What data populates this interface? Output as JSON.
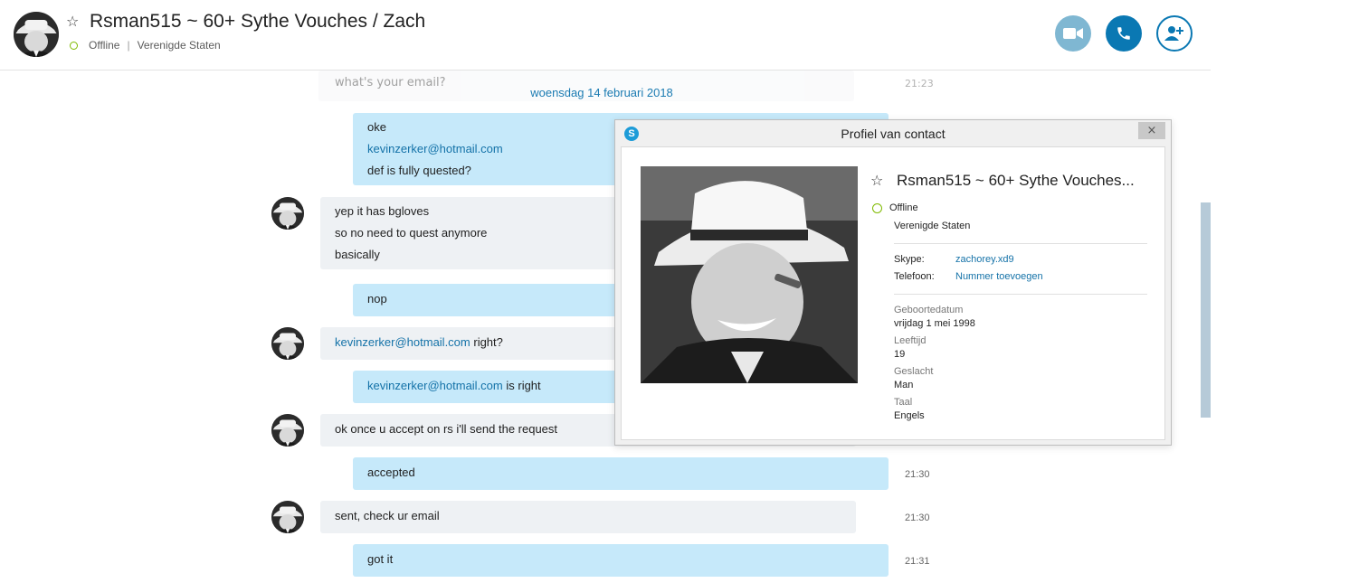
{
  "header": {
    "title": "Rsman515 ~ 60+ Sythe Vouches / Zach",
    "status": "Offline",
    "separator": "|",
    "location": "Verenigde Staten"
  },
  "chat": {
    "faded_message": "what's your email?",
    "faded_time": "21:23",
    "date_separator": "woensdag 14 februari 2018",
    "messages": [
      {
        "sender": "me",
        "lines": [
          "oke",
          "kevinzerker@hotmail.com",
          "def is fully quested?"
        ]
      },
      {
        "sender": "them",
        "lines": [
          "yep it has bgloves",
          "so no need to quest anymore",
          "basically"
        ]
      },
      {
        "sender": "me",
        "lines": [
          "nop"
        ]
      },
      {
        "sender": "them",
        "link": "kevinzerker@hotmail.com",
        "text": " right?"
      },
      {
        "sender": "me",
        "link": "kevinzerker@hotmail.com",
        "text": " is right"
      },
      {
        "sender": "them",
        "lines": [
          "ok once u accept on rs i'll send the request"
        ]
      },
      {
        "sender": "me",
        "lines": [
          "accepted"
        ],
        "time": "21:30"
      },
      {
        "sender": "them",
        "lines": [
          "sent, check ur email"
        ],
        "time": "21:30"
      },
      {
        "sender": "me",
        "lines": [
          "got it"
        ],
        "time": "21:31"
      }
    ]
  },
  "dialog": {
    "title": "Profiel van contact",
    "close_symbol": "×",
    "skype_logo_letter": "S",
    "name": "Rsman515 ~ 60+ Sythe Vouches...",
    "status": "Offline",
    "country": "Verenigde Staten",
    "skype_label": "Skype:",
    "skype_value": "zachorey.xd9",
    "phone_label": "Telefoon:",
    "phone_value": "Nummer toevoegen",
    "birthdate_label": "Geboortedatum",
    "birthdate_value": "vrijdag 1 mei 1998",
    "age_label": "Leeftijd",
    "age_value": "19",
    "gender_label": "Geslacht",
    "gender_value": "Man",
    "language_label": "Taal",
    "language_value": "Engels"
  },
  "icons": {
    "star": "star-icon",
    "video": "video-camera-icon",
    "call": "phone-icon",
    "add_contact": "add-person-icon"
  },
  "colors": {
    "accent": "#0a78b3",
    "video_button": "#7fb7d2",
    "my_bubble": "#c6e9fa",
    "their_bubble": "#eef1f4",
    "status_offline": "#7fba00",
    "link": "#1472a8"
  }
}
